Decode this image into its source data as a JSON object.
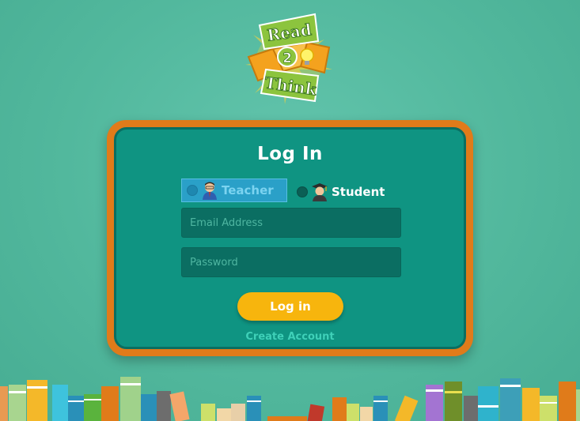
{
  "logo": {
    "line1": "Read",
    "line2": "2",
    "line3": "Think"
  },
  "login": {
    "title": "Log In",
    "roles": [
      {
        "label": "Teacher",
        "icon": "teacher-avatar-icon",
        "selected": true
      },
      {
        "label": "Student",
        "icon": "student-avatar-icon",
        "selected": false
      }
    ],
    "email_placeholder": "Email Address",
    "password_placeholder": "Password",
    "login_label": "Log in",
    "create_account_label": "Create Account"
  },
  "colors": {
    "background": "#52b89d",
    "panel_border": "#e07b1a",
    "panel_fill": "#0f9482",
    "button": "#f7b50d",
    "link": "#3fd0b8"
  }
}
